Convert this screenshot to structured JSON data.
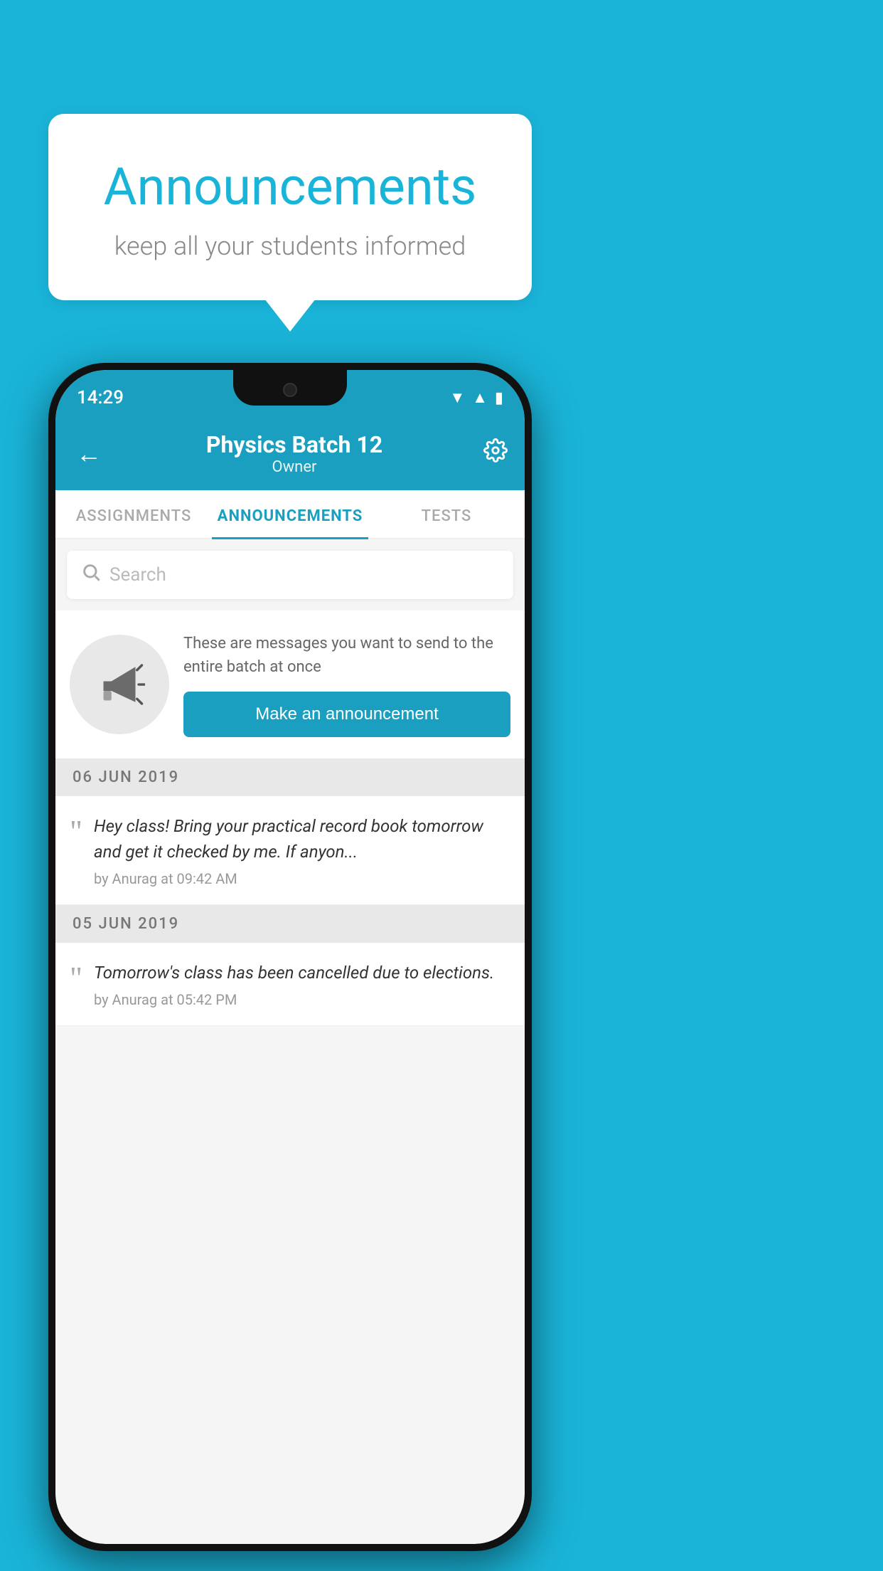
{
  "background_color": "#1ab4d8",
  "speech_bubble": {
    "title": "Announcements",
    "subtitle": "keep all your students informed"
  },
  "phone": {
    "status_bar": {
      "time": "14:29"
    },
    "header": {
      "title": "Physics Batch 12",
      "subtitle": "Owner",
      "back_label": "←",
      "settings_label": "⚙"
    },
    "tabs": [
      {
        "label": "ASSIGNMENTS",
        "active": false
      },
      {
        "label": "ANNOUNCEMENTS",
        "active": true
      },
      {
        "label": "TESTS",
        "active": false
      }
    ],
    "search": {
      "placeholder": "Search"
    },
    "promo": {
      "text": "These are messages you want to send to the entire batch at once",
      "button_label": "Make an announcement"
    },
    "announcements": [
      {
        "date": "06  JUN  2019",
        "items": [
          {
            "text": "Hey class! Bring your practical record book tomorrow and get it checked by me. If anyon...",
            "meta": "by Anurag at 09:42 AM"
          }
        ]
      },
      {
        "date": "05  JUN  2019",
        "items": [
          {
            "text": "Tomorrow's class has been cancelled due to elections.",
            "meta": "by Anurag at 05:42 PM"
          }
        ]
      }
    ]
  }
}
